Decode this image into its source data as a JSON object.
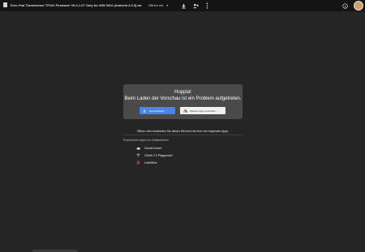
{
  "header": {
    "title": "Ever-Pad Transformer TF101 Firmware V9.2.1.27 Only for WW SKU (Android 4.0.3).rar",
    "open_with_label": "Öffnen mit"
  },
  "error_card": {
    "heading": "Hoppla!",
    "message": "Beim Laden der Vorschau ist ein Problem aufgetreten.",
    "download_label": "Herunterladen",
    "more_apps_label": "Weitere Apps verbinden..."
  },
  "open_with": {
    "prompt": "Öffnen oder bearbeiten Sie dieses Element mit einer der folgenden Apps",
    "suggested_label": "Empfohlene Apps von Drittanbietern",
    "apps": [
      {
        "label": "CloudConvert",
        "icon": "cloudconvert-icon"
      },
      {
        "label": "OAuth 2.0 Playground",
        "icon": "oauth-playground-icon"
      },
      {
        "label": "LetsOffice",
        "icon": "letsoffice-icon"
      }
    ]
  },
  "colors": {
    "background": "#252525",
    "topbar": "#141414",
    "card": "#4a4a4a",
    "primary_button": "#4a86e8"
  }
}
